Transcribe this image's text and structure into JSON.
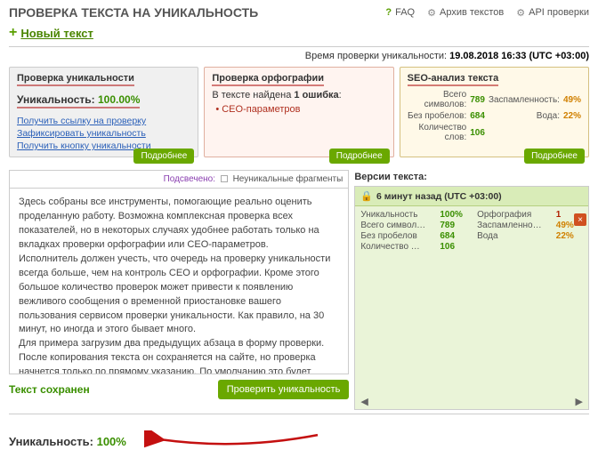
{
  "header": {
    "title": "ПРОВЕРКА ТЕКСТА НА УНИКАЛЬНОСТЬ",
    "links": {
      "faq": "FAQ",
      "archive": "Архив текстов",
      "api": "API проверки"
    }
  },
  "new_text": "Новый текст",
  "timestamp": {
    "label": "Время проверки уникальности:",
    "value": "19.08.2018 16:33 (UTC +03:00)"
  },
  "panel_uniq": {
    "title": "Проверка уникальности",
    "label": "Уникальность:",
    "value": "100.00%",
    "links": {
      "l1": "Получить ссылку на проверку",
      "l2": "Зафиксировать уникальность",
      "l3": "Получить кнопку уникальности"
    }
  },
  "panel_orfo": {
    "title": "Проверка орфографии",
    "sub_p1": "В тексте найдена ",
    "sub_p2": "1 ошибка",
    "sub_p3": ":",
    "item": "• СЕО-параметров"
  },
  "panel_seo": {
    "title": "SEO-анализ текста",
    "rows": {
      "r1l": "Всего символов:",
      "r1v": "789",
      "r2l": "Без пробелов:",
      "r2v": "684",
      "r3l": "Количество слов:",
      "r3v": "106",
      "s1l": "Заспамленность:",
      "s1v": "49%",
      "s2l": "Вода:",
      "s2v": "22%"
    }
  },
  "btn_more": "Подробнее",
  "highlight": {
    "label": "Подсвечено:",
    "frag": "Неуникальные фрагменты"
  },
  "body_text": "Здесь собраны все инструменты, помогающие реально оценить проделанную работу. Возможна комплексная проверка всех показателей, но в некоторых случаях удобнее работать только на вкладках проверки орфографии или СЕО-параметров.\nИсполнитель должен учесть, что очередь на проверку уникальности всегда больше, чем на контроль СЕО и орфографии. Кроме этого большое количество проверок может привести к появлению вежливого сообщения о временной приостановке вашего пользования сервисом проверки уникальности. Как правило, на 30 минут, но иногда и этого бывает много.\nДля примера загрузим два предыдущих абзаца в форму проверки. После копирования текста он сохраняется на сайте, но проверка начнется только по прямому указанию. По умолчанию это будет полная проверка уникальности, орфографии и СЕО.",
  "saved": "Текст сохранен",
  "btn_check": "Проверить уникальность",
  "versions": {
    "title": "Версии текста:",
    "head": "6 минут назад  (UTC +03:00)",
    "rows": {
      "uniq_l": "Уникальность",
      "uniq_v": "100%",
      "orfo_l": "Орфография",
      "orfo_v": "1",
      "chars_l": "Всего символ…",
      "chars_v": "789",
      "spam_l": "Заспамленно…",
      "spam_v": "49%",
      "nosp_l": "Без пробелов",
      "nosp_v": "684",
      "water_l": "Вода",
      "water_v": "22%",
      "words_l": "Количество …",
      "words_v": "106"
    }
  },
  "bottom": {
    "label": "Уникальность:",
    "value": "100%"
  }
}
